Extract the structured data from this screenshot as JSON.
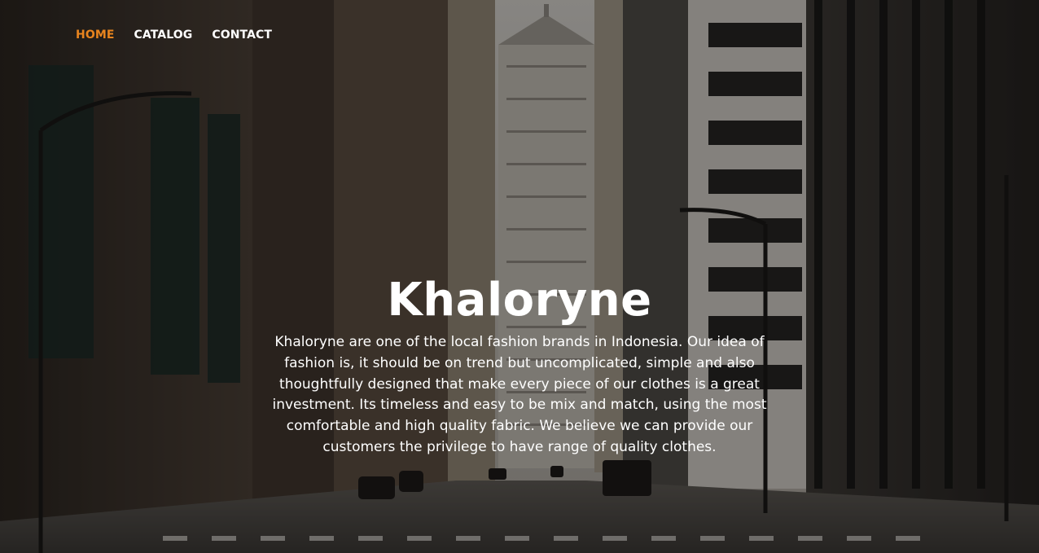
{
  "nav": {
    "items": [
      {
        "label": "HOME",
        "active": true
      },
      {
        "label": "CATALOG",
        "active": false
      },
      {
        "label": "CONTACT",
        "active": false
      }
    ],
    "active_color": "#e8841e"
  },
  "hero": {
    "title": "Khaloryne",
    "description": "Khaloryne are one of the local fashion brands in Indonesia. Our idea of fashion is, it should be on trend but uncomplicated, simple and also thoughtfully designed that make every piece of our clothes is a great investment. Its timeless and easy to be mix and match, using the most comfortable and high quality fabric. We believe we can provide our customers the privilege to have range of quality clothes."
  }
}
